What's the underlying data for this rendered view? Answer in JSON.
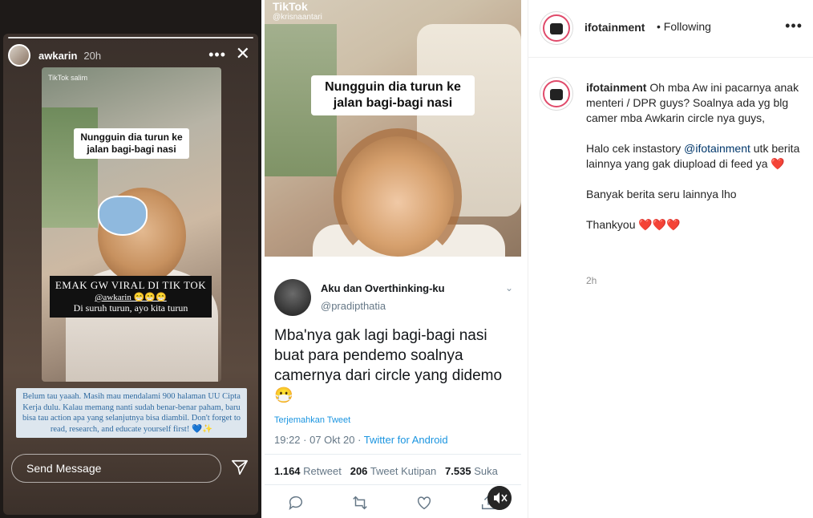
{
  "story": {
    "username": "awkarin",
    "time": "20h",
    "more_icon": "•••",
    "close_icon": "✕",
    "clip": {
      "watermark": "TikTok salim",
      "caption": "Nungguin dia turun ke jalan bagi-bagi nasi"
    },
    "text_block": {
      "line1": "EMAK GW VIRAL DI TIK TOK",
      "line2": "@awkarin 😁😁😁",
      "line3": "Di suruh turun, ayo kita turun"
    },
    "note": "Belum tau yaaah. Masih mau mendalami 900 halaman UU Cipta Kerja dulu. Kalau memang nanti sudah benar-benar paham, baru bisa tau action apa yang selanjutnya bisa diambil. Don't forget to read, research, and educate yourself first! 💙✨",
    "reply_placeholder": "Send Message"
  },
  "tiktok": {
    "logo": "TikTok",
    "handle": "@krisnaantari",
    "caption": "Nungguin dia turun ke jalan bagi-bagi nasi"
  },
  "tweet": {
    "name": "Aku dan Overthinking-ku",
    "handle": "@pradipthatia",
    "text": "Mba'nya gak lagi bagi-bagi nasi buat para pendemo soalnya camernya dari circle yang didemo 😷",
    "translate": "Terjemahkan Tweet",
    "timestamp": "19:22 · 07 Okt 20 · ",
    "source": "Twitter for Android",
    "retweets_count": "1.164",
    "retweets_label": "Retweet",
    "quotes_count": "206",
    "quotes_label": "Tweet Kutipan",
    "likes_count": "7.535",
    "likes_label": "Suka"
  },
  "instagram": {
    "username": "ifotainment",
    "follow_status": "• Following",
    "more_icon": "•••",
    "caption": {
      "username": "ifotainment",
      "p1": "Oh mba Aw ini pacarnya anak menteri / DPR guys? Soalnya ada yg blg camer mba Awkarin circle nya guys,",
      "p2_before": "Halo cek instastory ",
      "p2_mention": "@ifotainment",
      "p2_after": " utk berita lainnya yang gak diupload di feed ya ",
      "p2_heart": "❤️",
      "p3": "Banyak berita seru lainnya lho",
      "p4_text": "Thankyou ",
      "p4_hearts": "❤️❤️❤️"
    },
    "time": "2h"
  }
}
